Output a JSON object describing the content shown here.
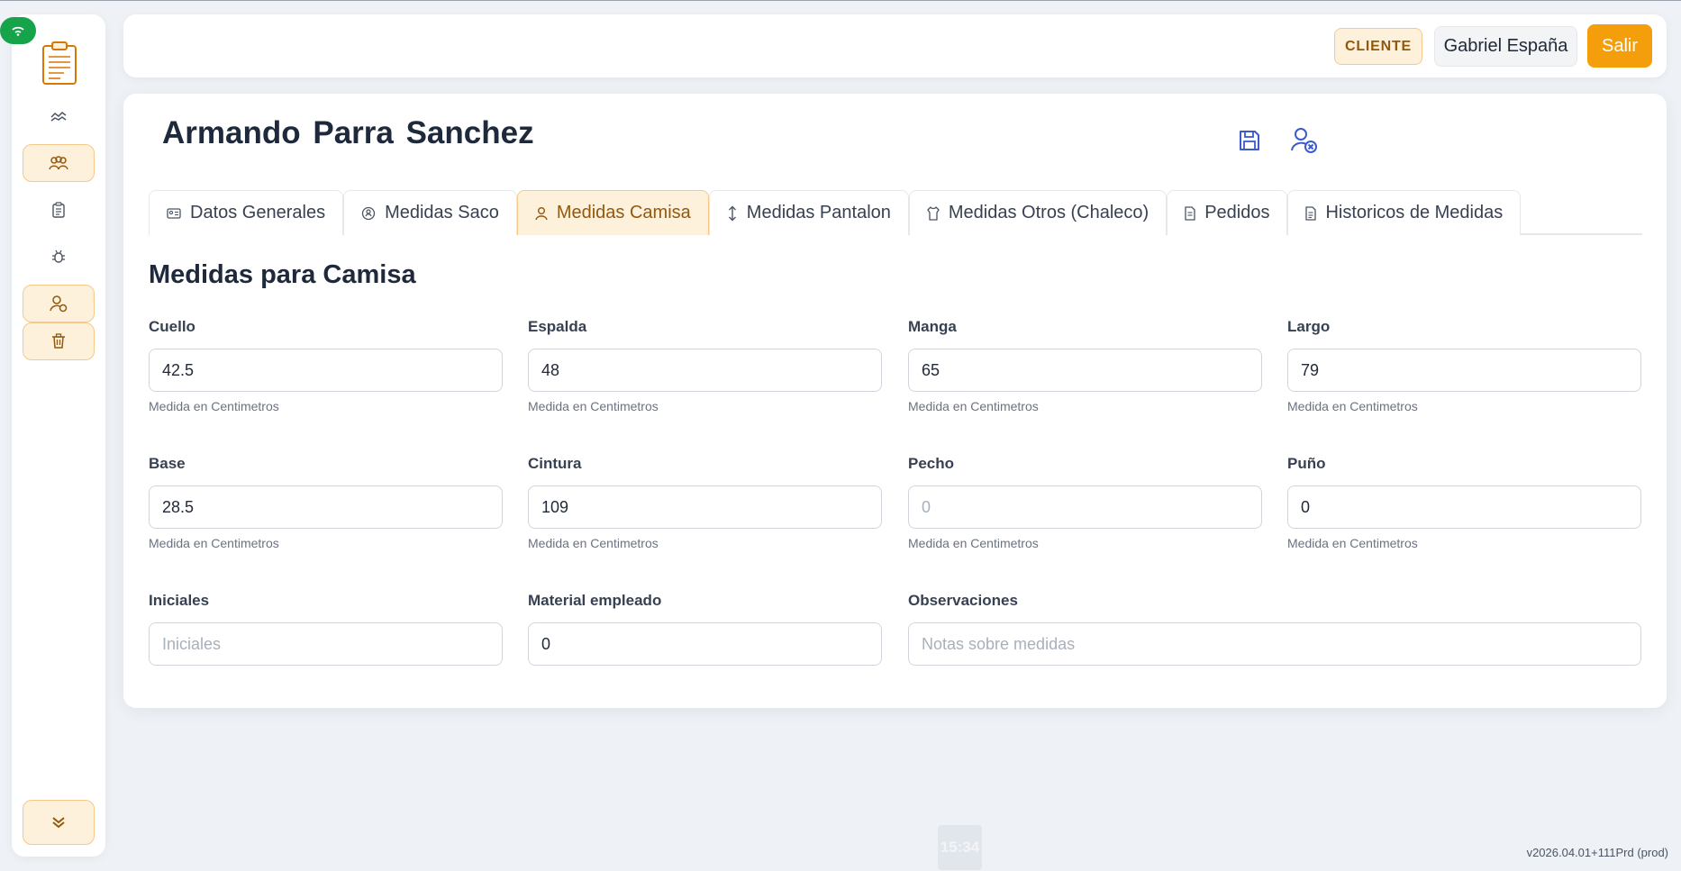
{
  "sidebar": {
    "items": [
      {
        "name": "dashboard",
        "icon": "chart-line-icon",
        "active": false
      },
      {
        "name": "clients",
        "icon": "users-group-icon",
        "active": true
      },
      {
        "name": "orders",
        "icon": "clipboard-icon",
        "active": false
      },
      {
        "name": "debug",
        "icon": "bug-icon",
        "active": false
      },
      {
        "name": "client-detail",
        "icon": "user-circles-icon",
        "active": true
      },
      {
        "name": "trash",
        "icon": "trash-icon",
        "active": true
      }
    ],
    "collapse_icon": "chevron-double-down-icon"
  },
  "header": {
    "role_badge": "CLIENTE",
    "user_name": "Gabriel España",
    "logout_label": "Salir"
  },
  "client": {
    "name": "Armando Parra Sanchez"
  },
  "tabs": [
    {
      "label": "Datos Generales",
      "icon": "id-card-icon",
      "active": false
    },
    {
      "label": "Medidas Saco",
      "icon": "jacket-icon",
      "active": false
    },
    {
      "label": "Medidas Camisa",
      "icon": "user-icon",
      "active": true
    },
    {
      "label": "Medidas Pantalon",
      "icon": "arrows-vertical-icon",
      "active": false
    },
    {
      "label": "Medidas Otros (Chaleco)",
      "icon": "shirt-icon",
      "active": false
    },
    {
      "label": "Pedidos",
      "icon": "file-icon",
      "active": false
    },
    {
      "label": "Historicos de Medidas",
      "icon": "file-text-icon",
      "active": false
    }
  ],
  "section": {
    "title": "Medidas para Camisa",
    "fields": {
      "cuello": {
        "label": "Cuello",
        "value": "42.5",
        "hint": "Medida en Centimetros"
      },
      "espalda": {
        "label": "Espalda",
        "value": "48",
        "hint": "Medida en Centimetros"
      },
      "manga": {
        "label": "Manga",
        "value": "65",
        "hint": "Medida en Centimetros"
      },
      "largo": {
        "label": "Largo",
        "value": "79",
        "hint": "Medida en Centimetros"
      },
      "base": {
        "label": "Base",
        "value": "28.5",
        "hint": "Medida en Centimetros"
      },
      "cintura": {
        "label": "Cintura",
        "value": "109",
        "hint": "Medida en Centimetros"
      },
      "pecho": {
        "label": "Pecho",
        "value": "",
        "placeholder": "0",
        "hint": "Medida en Centimetros"
      },
      "puno": {
        "label": "Puño",
        "value": "0",
        "hint": "Medida en Centimetros"
      },
      "iniciales": {
        "label": "Iniciales",
        "value": "",
        "placeholder": "Iniciales"
      },
      "material": {
        "label": "Material empleado",
        "value": "0"
      },
      "observaciones": {
        "label": "Observaciones",
        "value": "",
        "placeholder": "Notas sobre medidas"
      }
    }
  },
  "footer": {
    "clock": "15:34",
    "version": "v2026.04.01+111Prd (prod)"
  },
  "colors": {
    "accent": "#f59e0b",
    "accent_soft": "#fdf1dc",
    "accent_text": "#92580d",
    "icon_blue": "#3b5bcc",
    "online_green": "#16a34a"
  }
}
